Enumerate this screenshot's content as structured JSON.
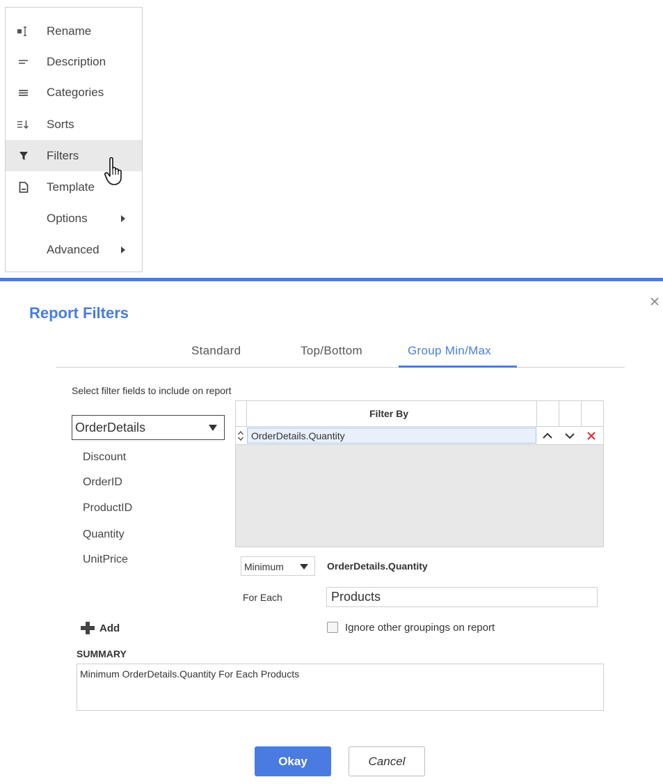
{
  "menu": {
    "items": [
      {
        "label": "Rename",
        "icon": "rename-icon"
      },
      {
        "label": "Description",
        "icon": "description-icon"
      },
      {
        "label": "Categories",
        "icon": "categories-icon"
      },
      {
        "label": "Sorts",
        "icon": "sorts-icon"
      },
      {
        "label": "Filters",
        "icon": "filter-icon",
        "active": true
      },
      {
        "label": "Template",
        "icon": "template-icon"
      },
      {
        "label": "Options",
        "icon": "submenu-arrow-icon"
      },
      {
        "label": "Advanced",
        "icon": "submenu-arrow-icon"
      }
    ]
  },
  "dialog": {
    "title": "Report Filters",
    "accent_color": "#4a7be0",
    "tabs": [
      {
        "label": "Standard"
      },
      {
        "label": "Top/Bottom"
      },
      {
        "label": "Group Min/Max",
        "active": true
      }
    ],
    "instruction": "Select filter fields to include on report",
    "entity_select": {
      "value": "OrderDetails"
    },
    "fields": [
      "Discount",
      "OrderID",
      "ProductID",
      "Quantity",
      "UnitPrice"
    ],
    "grid": {
      "header": "Filter By",
      "rows": [
        {
          "field": "OrderDetails.Quantity"
        }
      ]
    },
    "aggregate": {
      "value": "Minimum",
      "field": "OrderDetails.Quantity"
    },
    "for_each": {
      "label": "For Each",
      "value": "Products"
    },
    "ignore_groupings": {
      "label": "Ignore other groupings on report",
      "checked": false
    },
    "add_label": "Add",
    "summary": {
      "heading": "SUMMARY",
      "text": "Minimum OrderDetails.Quantity For Each Products"
    },
    "buttons": {
      "okay": "Okay",
      "cancel": "Cancel"
    }
  }
}
